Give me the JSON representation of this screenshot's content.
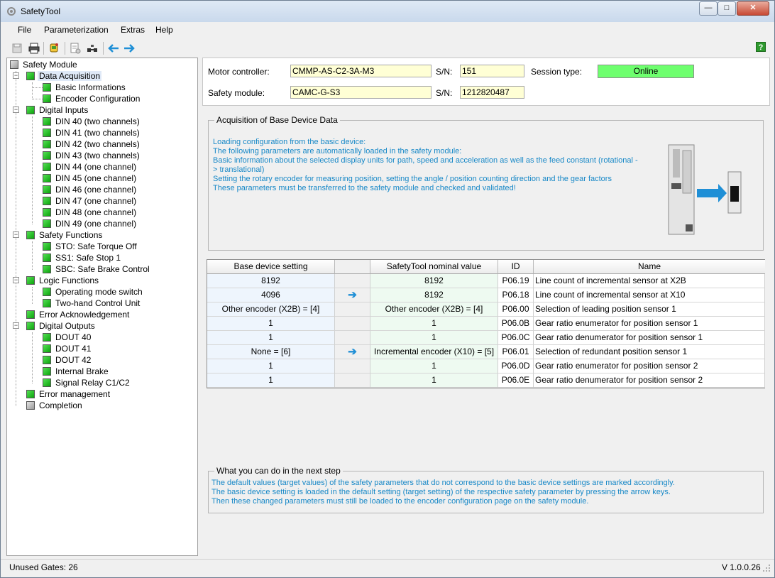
{
  "window": {
    "title": "SafetyTool",
    "min_symbol": "—",
    "max_symbol": "□",
    "close_symbol": "✕"
  },
  "menu": {
    "items": [
      "File",
      "Parameterization",
      "Extras",
      "Help"
    ]
  },
  "toolbar": {
    "help_label": "?"
  },
  "tree": {
    "root": "Safety Module",
    "data_acquisition": "Data Acquisition",
    "basic_informations": "Basic Informations",
    "encoder_configuration": "Encoder Configuration",
    "digital_inputs": "Digital Inputs",
    "din": [
      "DIN 40 (two channels)",
      "DIN 41 (two channels)",
      "DIN 42 (two channels)",
      "DIN 43 (two channels)",
      "DIN 44 (one channel)",
      "DIN 45 (one channel)",
      "DIN 46 (one channel)",
      "DIN 47 (one channel)",
      "DIN 48 (one channel)",
      "DIN 49 (one channel)"
    ],
    "safety_functions": "Safety Functions",
    "sf": [
      "STO: Safe Torque Off",
      "SS1: Safe Stop 1",
      "SBC: Safe Brake Control"
    ],
    "logic_functions": "Logic Functions",
    "lf": [
      "Operating mode switch",
      "Two-hand Control Unit"
    ],
    "error_acknowledgement": "Error Acknowledgement",
    "digital_outputs": "Digital Outputs",
    "do": [
      "DOUT 40",
      "DOUT 41",
      "DOUT 42",
      "Internal Brake",
      "Signal Relay C1/C2"
    ],
    "error_management": "Error management",
    "completion": "Completion"
  },
  "header": {
    "motor_controller_label": "Motor controller:",
    "motor_controller_value": "CMMP-AS-C2-3A-M3",
    "sn_label": "S/N:",
    "motor_sn": "151",
    "session_type_label": "Session type:",
    "session_type_value": "Online",
    "safety_module_label": "Safety module:",
    "safety_module_value": "CAMC-G-S3",
    "safety_sn": "1212820487"
  },
  "acquisition": {
    "title": "Acquisition of Base Device Data",
    "lines": [
      "Loading configuration from the basic device:",
      "The following parameters are automatically loaded in the safety module:",
      "Basic information about the selected display units for path, speed and acceleration as well as the feed constant (rotational -> translational)",
      "Setting the rotary encoder for measuring position, setting the angle / position counting direction and the gear factors",
      "These parameters must be transferred to the safety module and checked and validated!"
    ]
  },
  "table": {
    "headers": [
      "Base device setting",
      "",
      "SafetyTool nominal value",
      "ID",
      "Name"
    ],
    "rows": [
      {
        "base": "8192",
        "arrow": "",
        "nominal": "8192",
        "id": "P06.19",
        "name": "Line count of incremental sensor at X2B"
      },
      {
        "base": "4096",
        "arrow": "➔",
        "nominal": "8192",
        "id": "P06.18",
        "name": "Line count of incremental sensor at X10"
      },
      {
        "base": "Other encoder (X2B) = [4]",
        "arrow": "",
        "nominal": "Other encoder (X2B) = [4]",
        "id": "P06.00",
        "name": "Selection of leading position sensor 1"
      },
      {
        "base": "1",
        "arrow": "",
        "nominal": "1",
        "id": "P06.0B",
        "name": "Gear ratio enumerator for position sensor 1"
      },
      {
        "base": "1",
        "arrow": "",
        "nominal": "1",
        "id": "P06.0C",
        "name": "Gear ratio denumerator for position sensor 1"
      },
      {
        "base": "None = [6]",
        "arrow": "➔",
        "nominal": "Incremental encoder (X10) = [5]",
        "id": "P06.01",
        "name": "Selection of redundant position sensor 1"
      },
      {
        "base": "1",
        "arrow": "",
        "nominal": "1",
        "id": "P06.0D",
        "name": "Gear ratio enumerator for position sensor 2"
      },
      {
        "base": "1",
        "arrow": "",
        "nominal": "1",
        "id": "P06.0E",
        "name": "Gear ratio denumerator for position sensor 2"
      }
    ]
  },
  "next_step": {
    "title": "What you can do in the next step",
    "lines": [
      "The default values (target values) of the safety parameters that do not correspond to the basic device settings are marked accordingly.",
      "The basic device setting is loaded in the default setting (target setting) of the respective safety parameter by pressing the arrow keys.",
      "Then these changed parameters must still be loaded to the encoder configuration page on the safety module."
    ]
  },
  "status": {
    "unused_gates": "Unused Gates: 26",
    "version": "V 1.0.0.26"
  },
  "colors": {
    "info_text": "#1788c7",
    "online": "#6eff6e",
    "field_bg": "#ffffd5",
    "check_green": "#0ca40c"
  }
}
